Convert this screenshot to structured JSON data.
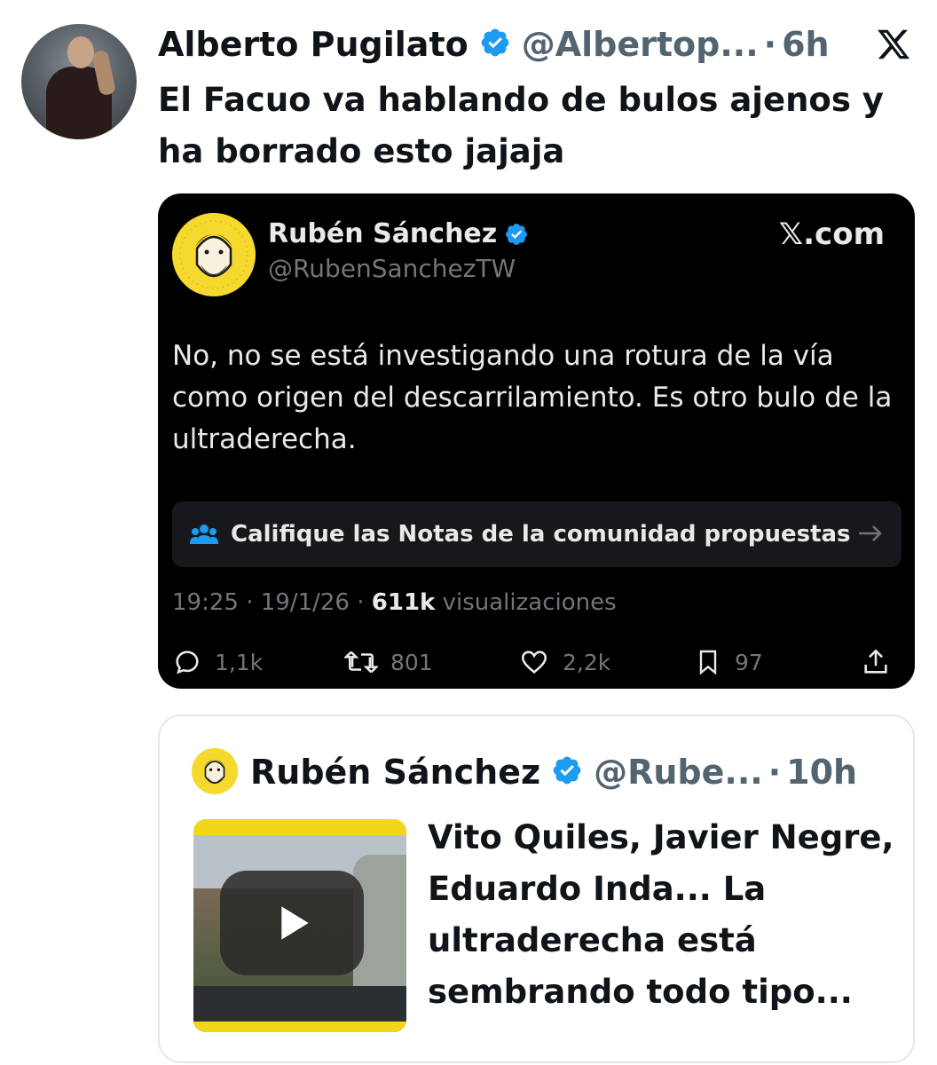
{
  "outer_tweet": {
    "author_name": "Alberto Pugilato",
    "author_handle": "@Albertop...",
    "separator": "·",
    "time": "6h",
    "text": "El Facuo va hablando de bulos ajenos y ha borrado esto jajaja"
  },
  "embedded_screenshot": {
    "author_name": "Rubén Sánchez",
    "author_handle": "@RubenSanchezTW",
    "site": "𝕏.com",
    "text": "No, no se está investigando una rotura de la vía como origen del descarrilamiento. Es otro bulo de la ultraderecha.",
    "community_notes_label": "Califique las Notas de la comunidad propuestas",
    "meta": {
      "time": "19:25",
      "sep1": "·",
      "date": "19/1/26",
      "sep2": "·",
      "views_count": "611k",
      "views_label": "visualizaciones"
    },
    "actions": {
      "replies": "1,1k",
      "reposts": "801",
      "likes": "2,2k",
      "bookmarks": "97"
    }
  },
  "quoted_tweet": {
    "author_name": "Rubén Sánchez",
    "author_handle": "@Rube...",
    "separator": "·",
    "time": "10h",
    "text": "Vito Quiles, Javier Negre, Eduardo Inda... La ultraderecha está sembrando todo tipo..."
  },
  "colors": {
    "verified_blue": "#1d9bf0",
    "text_primary": "#0f1419",
    "text_secondary": "#536471",
    "dark_bg": "#000000",
    "avatar_yellow": "#f5d92e"
  }
}
